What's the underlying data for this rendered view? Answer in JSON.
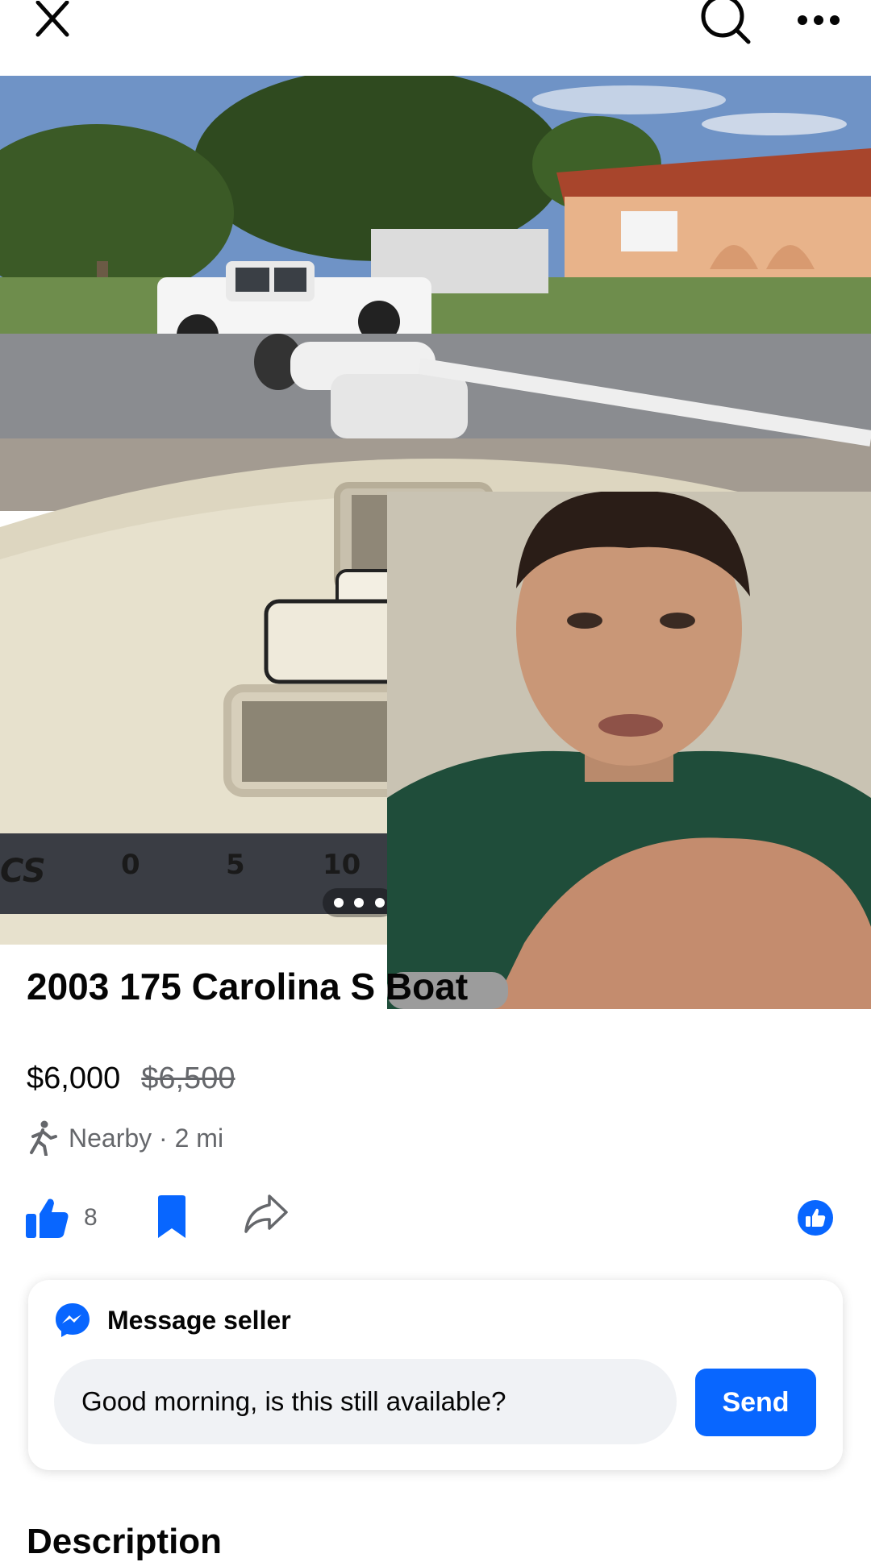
{
  "topbar": {
    "close_icon": "close-icon",
    "search_icon": "search-icon",
    "more_icon": "more-horizontal-icon"
  },
  "photo": {
    "description_icon": "listing-photo",
    "pagination_dots": 3
  },
  "listing": {
    "title": "2003 175 Carolina S Boat",
    "price": "$6,000",
    "original_price": "$6,500",
    "location": "Nearby · 2 mi"
  },
  "actions": {
    "like_count": "8",
    "like_icon": "thumbs-up-icon",
    "save_icon": "bookmark-icon",
    "share_icon": "share-icon",
    "reaction_icon": "like-reaction-icon"
  },
  "message": {
    "header": "Message seller",
    "input_value": "Good morning, is this still available?",
    "send_label": "Send"
  },
  "description": {
    "heading": "Description"
  },
  "colors": {
    "accent": "#0866ff",
    "text_secondary": "#65676b",
    "input_bg": "#f0f2f5"
  }
}
